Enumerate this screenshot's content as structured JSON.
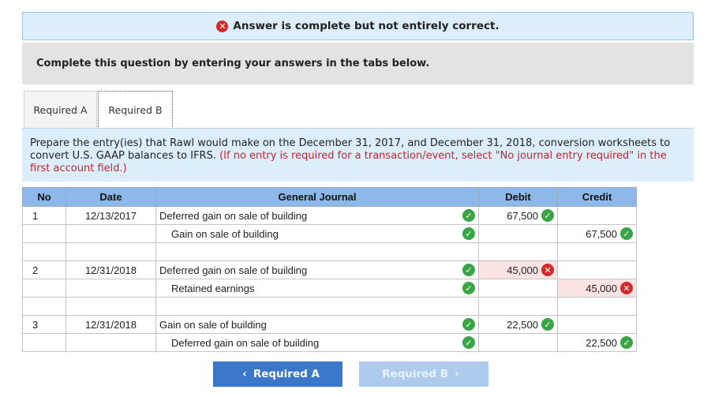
{
  "status": {
    "icon": "x-circle-icon",
    "icon_glyph": "✕",
    "text": "Answer is complete but not entirely correct.",
    "color": "#d22a2a"
  },
  "instruction": "Complete this question by entering your answers in the tabs below.",
  "tabs": [
    {
      "label": "Required A",
      "active": false
    },
    {
      "label": "Required B",
      "active": true
    }
  ],
  "question": {
    "text": "Prepare the entry(ies) that Rawl would make on the December 31, 2017, and December 31, 2018, conversion worksheets to convert U.S. GAAP balances to IFRS.",
    "hint": "(If no entry is required for a transaction/event, select \"No journal entry required\" in the first account field.)"
  },
  "journal": {
    "headers": [
      "No",
      "Date",
      "General Journal",
      "Debit",
      "Credit"
    ],
    "entries": [
      {
        "no": "1",
        "date": "12/13/2017",
        "debit_line": {
          "account": "Deferred gain on sale of building",
          "amount": "67,500",
          "amount_status": "correct"
        },
        "credit_line": {
          "account": "Gain on sale of building",
          "amount": "67,500",
          "amount_status": "correct"
        }
      },
      {
        "no": "2",
        "date": "12/31/2018",
        "debit_line": {
          "account": "Deferred gain on sale of building",
          "amount": "45,000",
          "amount_status": "incorrect"
        },
        "credit_line": {
          "account": "Retained earnings",
          "amount": "45,000",
          "amount_status": "incorrect"
        }
      },
      {
        "no": "3",
        "date": "12/31/2018",
        "debit_line": {
          "account": "Gain on sale of building",
          "amount": "22,500",
          "amount_status": "correct"
        },
        "credit_line": {
          "account": "Deferred gain on sale of building",
          "amount": "22,500",
          "amount_status": "correct"
        }
      }
    ],
    "check_glyph": "✓",
    "x_glyph": "✕",
    "colors": {
      "header": "#8db8e8",
      "correct": "#3aa447",
      "incorrect": "#d22a2a",
      "incorrect_bg": "#fbe3e3"
    }
  },
  "nav": {
    "prev_label": "Required A",
    "prev_chevron": "‹",
    "next_label": "Required B",
    "next_chevron": "›",
    "prev_color": "#3a77c8",
    "next_color": "#aecbee"
  }
}
